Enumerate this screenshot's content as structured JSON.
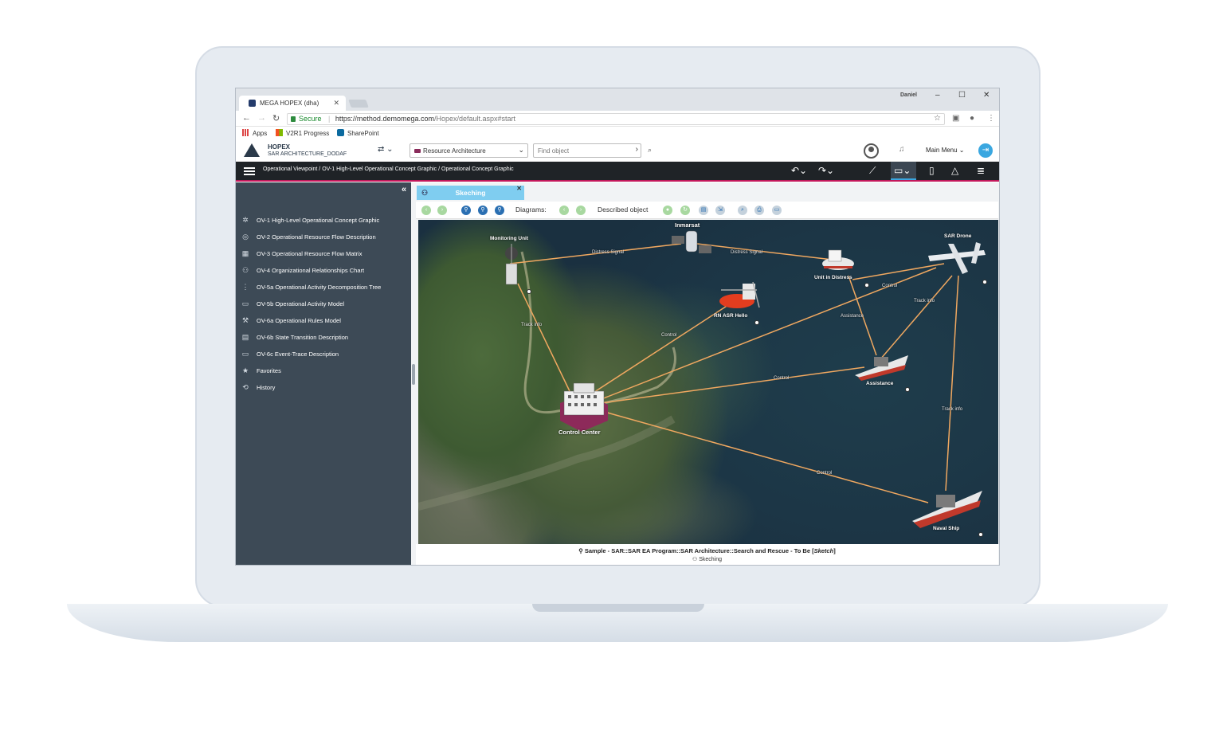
{
  "browser": {
    "tab_title": "MEGA HOPEX (dha)",
    "user": "Daniel",
    "secure_label": "Secure",
    "url_host": "https://method.demomega.com",
    "url_path": "/Hopex/default.aspx#start",
    "bookmarks": [
      "Apps",
      "V2R1 Progress",
      "SharePoint"
    ]
  },
  "app": {
    "name": "HOPEX",
    "repository": "SAR ARCHITECTURE_DODAF",
    "workspace": "Resource Architecture",
    "find_placeholder": "Find object",
    "main_menu": "Main Menu"
  },
  "toolbar": {
    "breadcrumb": "Operational Viewpoint / OV-1 High-Level Operational Concept Graphic / Operational Concept Graphic"
  },
  "sidebar": {
    "items": [
      {
        "label": "OV-1 High-Level Operational Concept Graphic",
        "icon": "concept-graphic-icon"
      },
      {
        "label": "OV-2 Operational Resource Flow Description",
        "icon": "resource-flow-icon"
      },
      {
        "label": "OV-3 Operational Resource Flow Matrix",
        "icon": "matrix-icon"
      },
      {
        "label": "OV-4 Organizational Relationships Chart",
        "icon": "org-chart-icon"
      },
      {
        "label": "OV-5a Operational Activity Decomposition Tree",
        "icon": "tree-icon"
      },
      {
        "label": "OV-5b Operational Activity Model",
        "icon": "activity-model-icon"
      },
      {
        "label": "OV-6a Operational Rules Model",
        "icon": "gavel-icon"
      },
      {
        "label": "OV-6b State Transition Description",
        "icon": "state-transition-icon"
      },
      {
        "label": "OV-6c Event-Trace Description",
        "icon": "event-trace-icon"
      },
      {
        "label": "Favorites",
        "icon": "star-icon"
      },
      {
        "label": "History",
        "icon": "history-icon"
      }
    ]
  },
  "diagram_tab": {
    "label": "Skeching",
    "diagrams_label": "Diagrams:",
    "described_object_label": "Described object"
  },
  "diagram": {
    "nodes": {
      "monitoring_unit": "Monitoring Unit",
      "inmarsat": "Inmarsat",
      "unit_in_distress": "Unit in Distress",
      "sar_drone": "SAR Drone",
      "rn_asr_hello": "RN ASR Hello",
      "assistance": "Assistance",
      "control_center": "Control Center",
      "naval_ship": "Naval Ship"
    },
    "edges": {
      "distress_signal_1": "Distress Signal",
      "distress_signal_2": "Distress Signal",
      "track_info_1": "Track info",
      "control_1": "Control",
      "control_2": "Control",
      "control_3": "Control",
      "control_4": "Control",
      "assistance": "Assistance",
      "track_info_2": "Track info",
      "track_info_3": "Track info"
    }
  },
  "caption": {
    "title": "Sample - SAR::SAR EA Program::SAR Architecture::Search and Rescue - To Be [",
    "title_italic": "Sketch",
    "title_end": "]",
    "subtitle": "Skeching"
  },
  "colors": {
    "accent": "#3aa7e0",
    "toolbar_underline": "#c2185b",
    "sidebar": "#3d4a56",
    "link_line": "#f0a860"
  }
}
